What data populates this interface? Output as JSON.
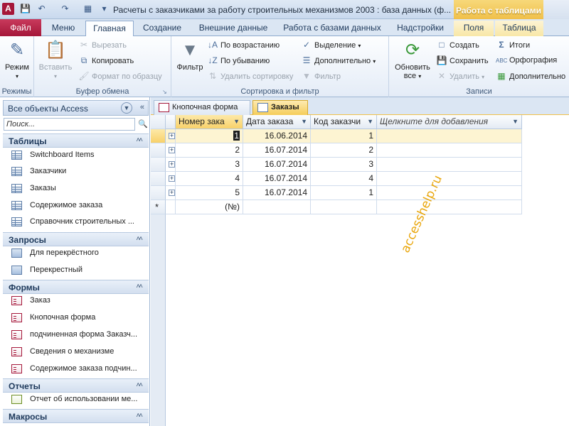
{
  "titlebar": {
    "title": "Расчеты с заказчиками за работу строительных механизмов 2003 : база данных (ф...",
    "context_tab_group": "Работа с таблицами",
    "icons": [
      "app-logo",
      "save-icon",
      "undo-icon",
      "redo-icon",
      "customize-icon"
    ]
  },
  "ribbon_tabs": [
    {
      "label": "Файл"
    },
    {
      "label": "Меню"
    },
    {
      "label": "Главная"
    },
    {
      "label": "Создание"
    },
    {
      "label": "Внешние данные"
    },
    {
      "label": "Работа с базами данных"
    },
    {
      "label": "Надстройки"
    },
    {
      "label": "Поля"
    },
    {
      "label": "Таблица"
    }
  ],
  "ribbon": {
    "views": {
      "group": "Режимы",
      "mode": "Режим"
    },
    "clipboard": {
      "group": "Буфер обмена",
      "paste": "Вставить",
      "cut": "Вырезать",
      "copy": "Копировать",
      "format_painter": "Формат по образцу"
    },
    "sort_filter": {
      "group": "Сортировка и фильтр",
      "filter": "Фильтр",
      "ascending": "По возрастанию",
      "descending": "По убыванию",
      "remove_sort": "Удалить сортировку",
      "selection": "Выделение",
      "advanced": "Дополнительно",
      "toggle_filter": "Фильтр"
    },
    "records": {
      "group": "Записи",
      "refresh": "Обновить",
      "refresh_all": "все",
      "new": "Создать",
      "save": "Сохранить",
      "delete": "Удалить",
      "totals": "Итоги",
      "spelling": "Орфография",
      "more": "Дополнительно"
    }
  },
  "nav": {
    "title": "Все объекты Access",
    "search_placeholder": "Поиск...",
    "groups": {
      "tables": {
        "label": "Таблицы",
        "items": [
          "Switchboard Items",
          "Заказчики",
          "Заказы",
          "Содержимое заказа",
          "Справочник строительных ..."
        ]
      },
      "queries": {
        "label": "Запросы",
        "items": [
          "Для перекрёстного",
          "Перекрестный"
        ]
      },
      "forms": {
        "label": "Формы",
        "items": [
          "Заказ",
          "Кнопочная форма",
          "подчиненная форма Заказч...",
          "Сведения о механизме",
          "Содержимое заказа подчин..."
        ]
      },
      "reports": {
        "label": "Отчеты",
        "items": [
          "Отчет об использовании ме..."
        ]
      },
      "macros": {
        "label": "Макросы"
      }
    }
  },
  "doc_tabs": [
    {
      "label": "Кнопочная форма"
    },
    {
      "label": "Заказы"
    }
  ],
  "datasheet": {
    "columns": [
      "Номер зака",
      "Дата заказа",
      "Код заказчи",
      "Щелкните для добавления"
    ],
    "rows": [
      {
        "num": "1",
        "date": "16.06.2014",
        "customer": "1"
      },
      {
        "num": "2",
        "date": "16.07.2014",
        "customer": "2"
      },
      {
        "num": "3",
        "date": "16.07.2014",
        "customer": "3"
      },
      {
        "num": "4",
        "date": "16.07.2014",
        "customer": "4"
      },
      {
        "num": "5",
        "date": "16.07.2014",
        "customer": "1"
      }
    ],
    "new_row_marker": "*",
    "new_row_placeholder": "(№)"
  },
  "watermark": "accesshelp.ru"
}
